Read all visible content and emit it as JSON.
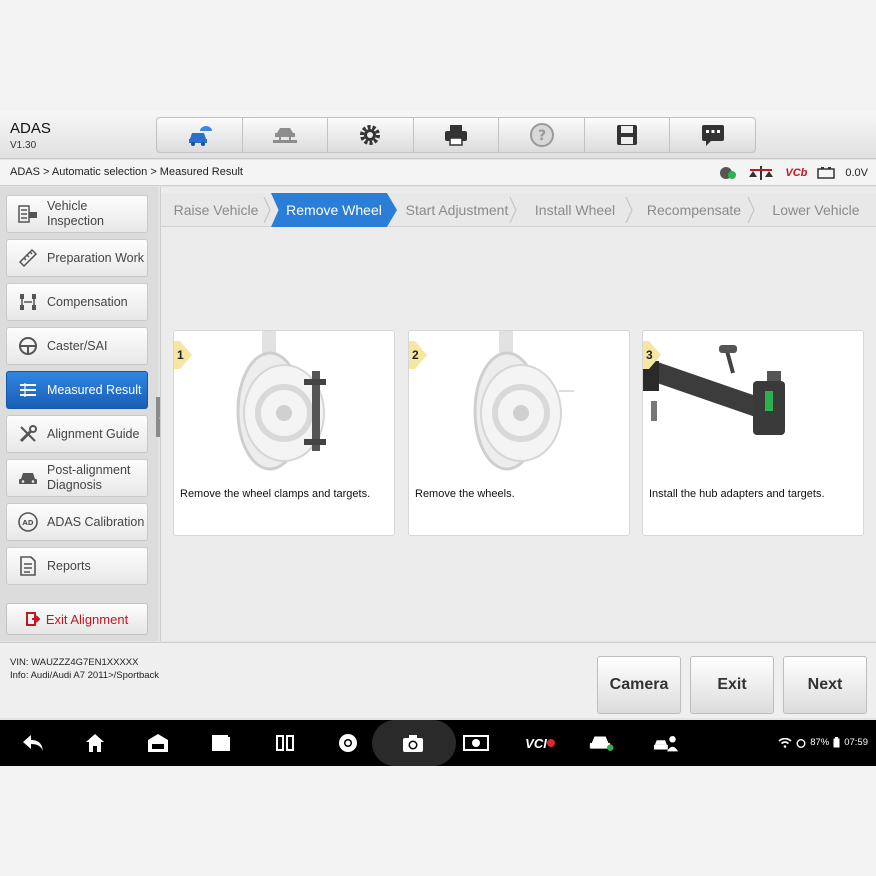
{
  "header": {
    "title": "ADAS",
    "version": "V1.30"
  },
  "toolbar": {
    "buttons": [
      "home-car-icon",
      "vehicle-lift-icon",
      "gear-icon",
      "printer-icon",
      "help-icon",
      "save-icon",
      "message-icon"
    ]
  },
  "breadcrumb": "ADAS > Automatic selection > Measured Result",
  "status": {
    "vcb": "VCb",
    "voltage": "0.0V"
  },
  "sidebar": {
    "items": [
      {
        "label": "Vehicle Inspection",
        "icon": "checklist-car-icon"
      },
      {
        "label": "Preparation Work",
        "icon": "ruler-icon"
      },
      {
        "label": "Compensation",
        "icon": "frame-icon"
      },
      {
        "label": "Caster/SAI",
        "icon": "steering-wheel-icon"
      },
      {
        "label": "Measured Result",
        "icon": "list-icon"
      },
      {
        "label": "Alignment Guide",
        "icon": "wrench-icon"
      },
      {
        "label": "Post-alignment Diagnosis",
        "icon": "car-icon"
      },
      {
        "label": "ADAS Calibration",
        "icon": "adas-icon"
      },
      {
        "label": "Reports",
        "icon": "report-icon"
      }
    ],
    "active_index": 4,
    "exit_label": "Exit Alignment"
  },
  "steps": {
    "items": [
      "Raise Vehicle",
      "Remove Wheel",
      "Start Adjustment",
      "Install Wheel",
      "Recompensate",
      "Lower Vehicle"
    ],
    "active_index": 1
  },
  "cards": [
    {
      "num": "1",
      "text": "Remove the wheel clamps and targets."
    },
    {
      "num": "2",
      "text": "Remove the wheels."
    },
    {
      "num": "3",
      "text": "Install the hub adapters and targets."
    }
  ],
  "footer": {
    "vin": "VIN: WAUZZZ4G7EN1XXXXX",
    "info": "Info: Audi/Audi A7 2011>/Sportback",
    "camera": "Camera",
    "exit": "Exit",
    "next": "Next"
  },
  "navbar": {
    "vci": "VCI",
    "battery": "87%",
    "time": "07:59"
  },
  "colors": {
    "accent": "#2a7ed8",
    "exit_red": "#c01822"
  }
}
